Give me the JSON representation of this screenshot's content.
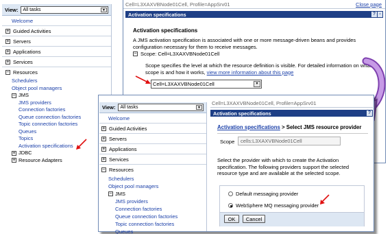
{
  "back": {
    "nav": {
      "view_label": "View:",
      "view_value": "All tasks",
      "welcome": "Welcome",
      "categories": {
        "guided": "Guided Activities",
        "servers": "Servers",
        "applications": "Applications",
        "services": "Services",
        "resources": "Resources"
      },
      "resources_items": {
        "schedulers": "Schedulers",
        "object_pool": "Object pool managers",
        "jms": "JMS",
        "jms_providers": "JMS providers",
        "connection_factories": "Connection factories",
        "queue_cf": "Queue connection factories",
        "topic_cf": "Topic connection factories",
        "queues": "Queues",
        "topics": "Topics",
        "activation_specs": "Activation specifications",
        "jdbc": "JDBC",
        "resource_adapters": "Resource Adapters"
      }
    },
    "content": {
      "path": "Cell=L3XAXVBNode01Cell, Profile=AppSrv01",
      "close_page": "Close page",
      "panel_title": "Activation specifications",
      "help_glyph": "?",
      "heading": "Activation specifications",
      "description": "A JMS activation specification is associated with one or more message-driven beans and provides configuration necessary for them to receive messages.",
      "scope_label": "Scope: Cell=L3XAXVBNode01Cell",
      "scope_text": "Scope specifies the level at which the resource definition is visible. For detailed information on what scope is and how it works,",
      "scope_link": "view more information about this page",
      "scope_select": "Cell=L3XAXVBNode01Cell"
    }
  },
  "front": {
    "nav": {
      "view_label": "View:",
      "view_value": "All tasks",
      "welcome": "Welcome",
      "categories": {
        "guided": "Guided Activities",
        "servers": "Servers",
        "applications": "Applications",
        "services": "Services",
        "resources": "Resources"
      },
      "resources_items": {
        "schedulers": "Schedulers",
        "object_pool": "Object pool managers",
        "jms": "JMS",
        "jms_providers": "JMS providers",
        "connection_factories": "Connection factories",
        "queue_cf": "Queue connection factories",
        "topic_cf": "Topic connection factories",
        "queues": "Queues"
      }
    },
    "content": {
      "path": "Cell=L3XAXVBNode01Cell, Profile=AppSrv01",
      "panel_title": "Activation specifications",
      "help_glyph": "?",
      "breadcrumb_link": "Activation specifications",
      "breadcrumb_rest": "> Select JMS resource provider",
      "scope_label": "Scope",
      "scope_value": "cells:L3XAXVBNode01Cell",
      "description": "Select the provider with which to create the Activation specification. The following providers support the selected resource type and are available at the selected scope.",
      "option_default": "Default messaging provider",
      "option_mq": "WebSphere MQ messaging provider",
      "ok": "OK",
      "cancel": "Cancel"
    }
  },
  "colors": {
    "title_bar": "#1e3f86",
    "link": "#1a3fa8",
    "arrow": "#e01010",
    "curve_arrow": "#9b59c6"
  },
  "icons": [
    "plus-icon",
    "minus-icon",
    "red-arrow-icon",
    "curved-arrow-icon",
    "dropdown-icon",
    "help-icon"
  ]
}
